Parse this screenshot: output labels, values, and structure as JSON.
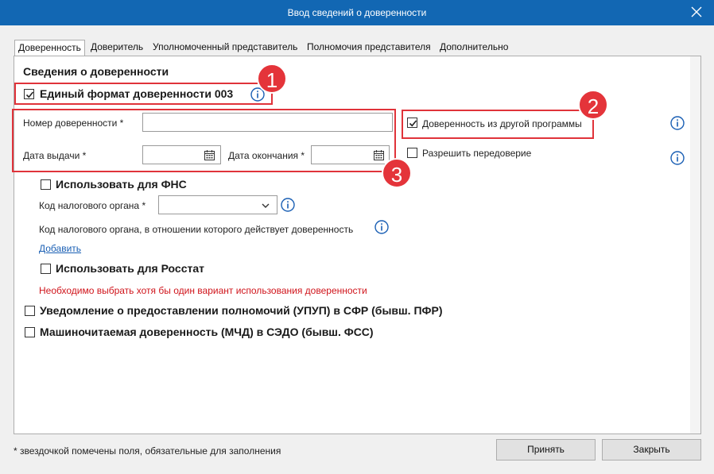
{
  "window": {
    "title": "Ввод сведений о доверенности"
  },
  "tabs": [
    {
      "label": "Доверенность"
    },
    {
      "label": "Доверитель"
    },
    {
      "label": "Уполномоченный представитель"
    },
    {
      "label": "Полномочия представителя"
    },
    {
      "label": "Дополнительно"
    }
  ],
  "section": {
    "title": "Сведения о доверенности",
    "unified_format": {
      "label": "Единый формат доверенности 003",
      "checked": true
    },
    "number_label": "Номер доверенности *",
    "number_value": "",
    "issue_date_label": "Дата выдачи *",
    "end_date_label": "Дата окончания *",
    "other_program": {
      "label": "Доверенность из другой программы",
      "checked": true
    },
    "allow_redelegation": {
      "label": "Разрешить передоверие",
      "checked": false
    },
    "use_fns": {
      "label": "Использовать для ФНС",
      "checked": false
    },
    "tax_code_label": "Код налогового органа *",
    "tax_code_value": "",
    "tax_code_effective_label": "Код налогового органа, в отношении которого действует доверенность",
    "add_link": "Добавить",
    "use_rosstat": {
      "label": "Использовать для Росстат",
      "checked": false
    },
    "error_text": "Необходимо выбрать хотя бы один вариант использования доверенности",
    "upup": {
      "label": "Уведомление о предоставлении полномочий (УПУП) в СФР (бывш. ПФР)",
      "checked": false
    },
    "mchd": {
      "label": "Машиночитаемая доверенность (МЧД) в СЭДО (бывш. ФСС)",
      "checked": false
    }
  },
  "badges": {
    "one": "1",
    "two": "2",
    "three": "3"
  },
  "footer": {
    "note": "* звездочкой помечены поля, обязательные для заполнения",
    "accept_label": "Принять",
    "close_label": "Закрыть"
  },
  "colors": {
    "titlebar": "#1267b3",
    "highlight": "#e0333a",
    "link": "#1a5fb4",
    "error": "#d0141b",
    "info": "#1a5fb4"
  }
}
